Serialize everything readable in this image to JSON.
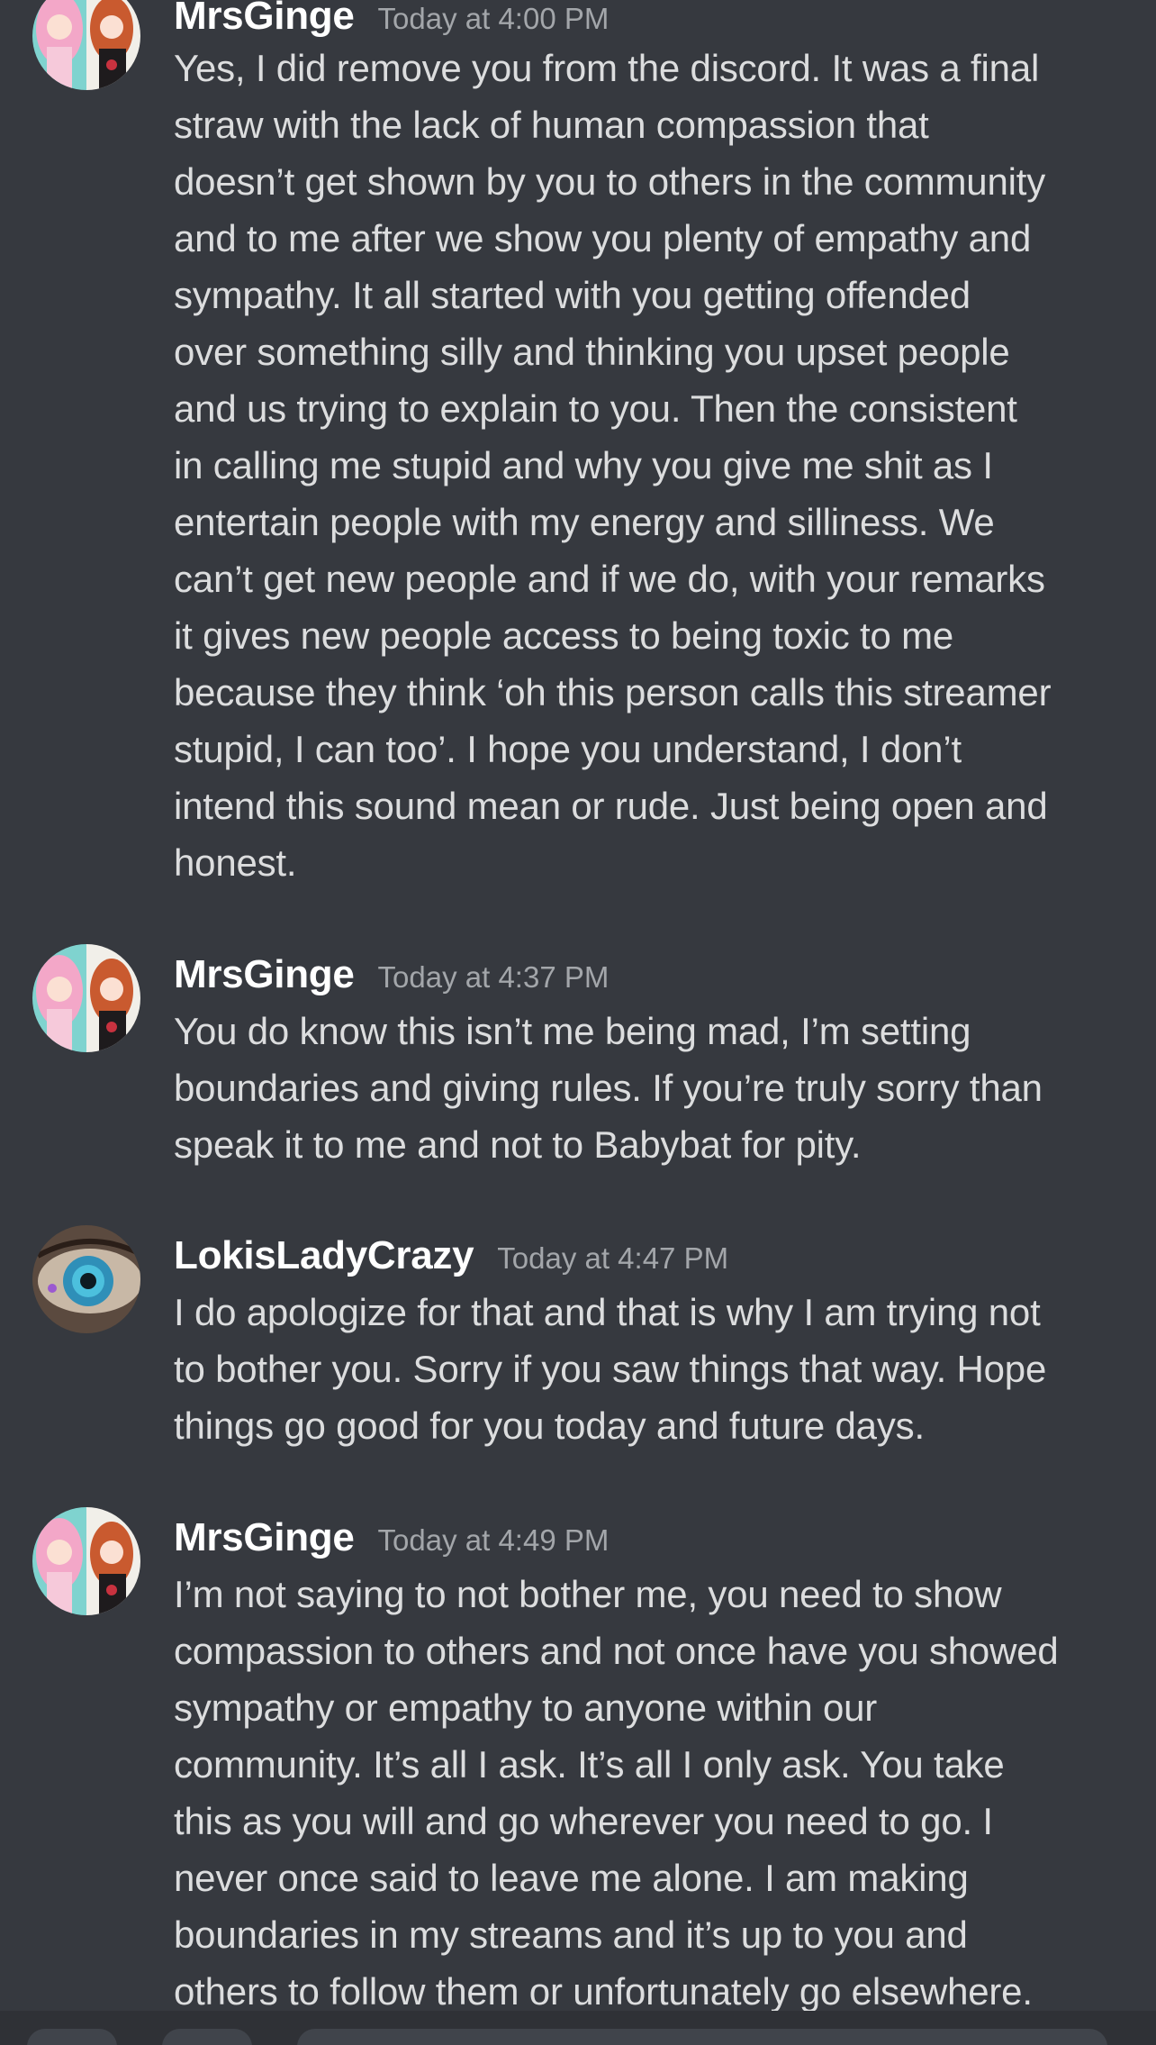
{
  "messages": [
    {
      "author": "MrsGinge",
      "timestamp": "Today at 4:00 PM",
      "avatar": "anime-characters-avatar",
      "lines": [
        "Yes, I did remove you from the discord. It was a final",
        "straw with the lack of human compassion that",
        "doesn’t get shown by you to others in the community",
        "and to me after we show you plenty of empathy and",
        "sympathy. It all started with you getting offended",
        "over something silly and thinking you upset people",
        "and us trying to explain to you. Then the consistent",
        "in calling me stupid and why you give me shit as I",
        "entertain people with my energy and silliness. We",
        "can’t get new people and if we do, with your remarks",
        "it gives new people access to being toxic to me",
        "because they think ‘oh this person calls this streamer",
        "stupid, I can too’. I hope you understand, I don’t",
        "intend this sound mean or rude. Just being open and",
        "honest."
      ]
    },
    {
      "author": "MrsGinge",
      "timestamp": "Today at 4:37 PM",
      "avatar": "anime-characters-avatar",
      "lines": [
        "You do know this isn’t me being mad, I’m setting",
        "boundaries and giving rules. If you’re truly sorry than",
        "speak it to me and not to Babybat for pity."
      ]
    },
    {
      "author": "LokisLadyCrazy",
      "timestamp": "Today at 4:47 PM",
      "avatar": "eye-closeup-avatar",
      "lines": [
        "I do apologize for that and that is why I am trying not",
        "to bother you. Sorry if you saw things that way. Hope",
        "things go good for you today and future days."
      ]
    },
    {
      "author": "MrsGinge",
      "timestamp": "Today at 4:49 PM",
      "avatar": "anime-characters-avatar",
      "lines": [
        "I’m not saying to not bother me, you need to show",
        "compassion to others and not once have you showed",
        "sympathy or empathy to anyone within our",
        "community. It’s all I ask. It’s all I only ask. You take",
        "this as you will and go wherever you need to go. I",
        "never once said to leave me alone. I am making",
        "boundaries in my streams and it’s up to you and",
        "others to follow them or unfortunately go elsewhere."
      ]
    }
  ],
  "colors": {
    "background": "#36393f",
    "author": "#ffffff",
    "timestamp": "#a3a6aa",
    "text": "#dcddde"
  }
}
